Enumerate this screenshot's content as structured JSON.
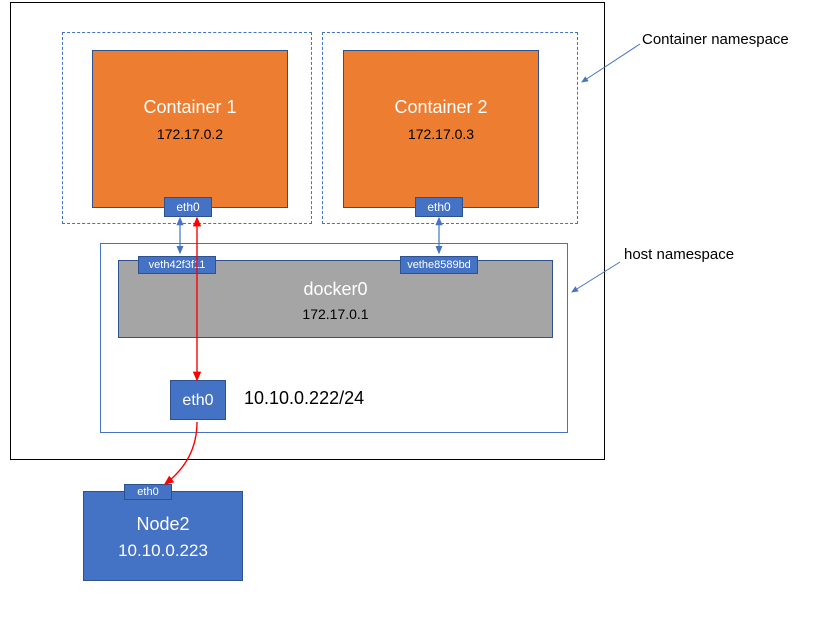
{
  "labels": {
    "container_namespace": "Container namespace",
    "host_namespace": "host namespace"
  },
  "containers": [
    {
      "name": "Container 1",
      "ip": "172.17.0.2",
      "iface": "eth0",
      "veth": "veth42f3f11"
    },
    {
      "name": "Container 2",
      "ip": "172.17.0.3",
      "iface": "eth0",
      "veth": "vethe8589bd"
    }
  ],
  "bridge": {
    "name": "docker0",
    "ip": "172.17.0.1"
  },
  "host": {
    "iface": "eth0",
    "ip_cidr": "10.10.0.222/24"
  },
  "node2": {
    "name": "Node2",
    "ip": "10.10.0.223",
    "iface": "eth0"
  },
  "colors": {
    "blue": "#4472c4",
    "orange": "#ed7d31",
    "gray": "#a5a5a5",
    "red": "#ff0000"
  }
}
